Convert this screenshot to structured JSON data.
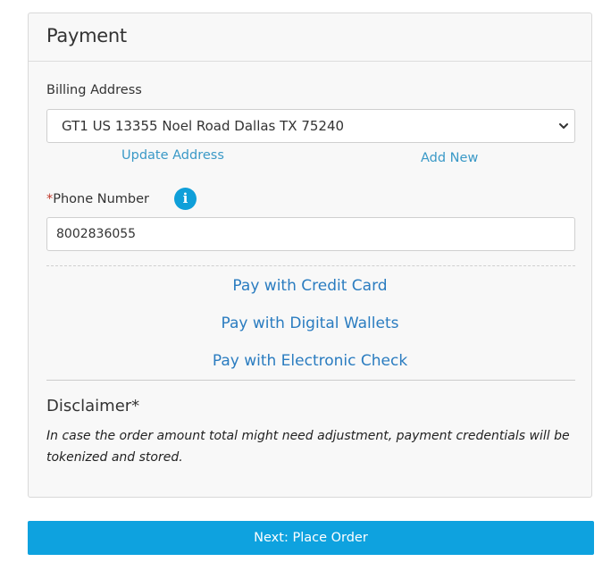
{
  "panel": {
    "title": "Payment"
  },
  "billing": {
    "label": "Billing Address",
    "selected_address": "GT1 US 13355 Noel Road Dallas TX 75240",
    "update_link": "Update Address",
    "add_link": "Add New"
  },
  "phone": {
    "required_marker": "*",
    "label": "Phone Number",
    "info_glyph": "i",
    "value": "8002836055"
  },
  "payment_methods": [
    {
      "label": "Pay with Credit Card"
    },
    {
      "label": "Pay with Digital Wallets"
    },
    {
      "label": "Pay with Electronic Check"
    }
  ],
  "disclaimer": {
    "title": "Disclaimer*",
    "text": "In case the order amount total might need adjustment, payment credentials will be tokenized and stored."
  },
  "actions": {
    "next_label": "Next: Place Order"
  },
  "icons": {
    "info": "info-icon",
    "select_chevron": "chevron-down-icon"
  },
  "colors": {
    "primary_button": "#0ea2df",
    "link": "#2a7cc0",
    "info_icon": "#0f9fd9",
    "required": "#c0392b"
  }
}
